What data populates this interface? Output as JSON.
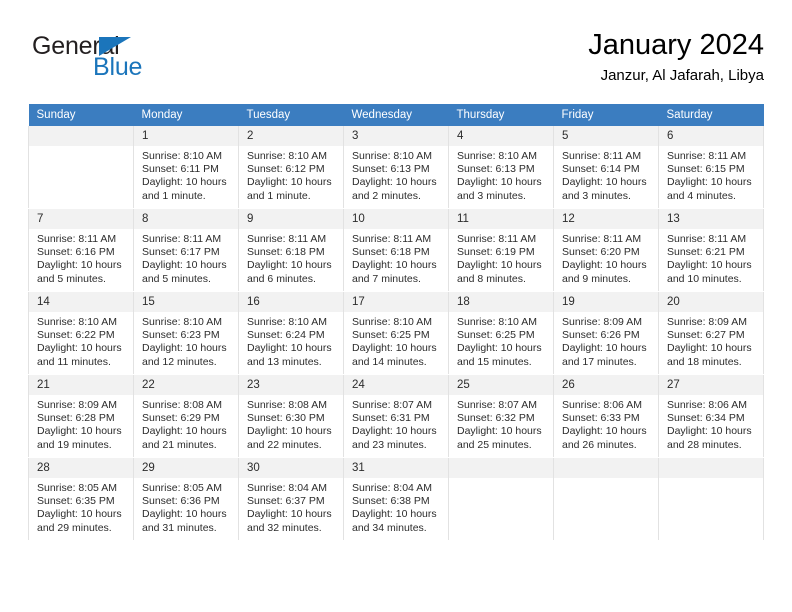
{
  "logo": {
    "word_top": "General",
    "word_bottom": "Blue",
    "triangle_color": "#1b75bb",
    "text_color": "#231f20"
  },
  "header": {
    "title": "January 2024",
    "subtitle": "Janzur, Al Jafarah, Libya"
  },
  "theme": {
    "header_bg": "#3b7dc0",
    "header_text": "#ffffff",
    "daynum_bg": "#f2f2f2",
    "cell_border": "#e2e2e2"
  },
  "weekday_headers": [
    "Sunday",
    "Monday",
    "Tuesday",
    "Wednesday",
    "Thursday",
    "Friday",
    "Saturday"
  ],
  "weeks": [
    [
      {
        "day": "",
        "sunrise": "",
        "sunset": "",
        "daylight": "",
        "blank": true
      },
      {
        "day": "1",
        "sunrise": "Sunrise: 8:10 AM",
        "sunset": "Sunset: 6:11 PM",
        "daylight": "Daylight: 10 hours and 1 minute."
      },
      {
        "day": "2",
        "sunrise": "Sunrise: 8:10 AM",
        "sunset": "Sunset: 6:12 PM",
        "daylight": "Daylight: 10 hours and 1 minute."
      },
      {
        "day": "3",
        "sunrise": "Sunrise: 8:10 AM",
        "sunset": "Sunset: 6:13 PM",
        "daylight": "Daylight: 10 hours and 2 minutes."
      },
      {
        "day": "4",
        "sunrise": "Sunrise: 8:10 AM",
        "sunset": "Sunset: 6:13 PM",
        "daylight": "Daylight: 10 hours and 3 minutes."
      },
      {
        "day": "5",
        "sunrise": "Sunrise: 8:11 AM",
        "sunset": "Sunset: 6:14 PM",
        "daylight": "Daylight: 10 hours and 3 minutes."
      },
      {
        "day": "6",
        "sunrise": "Sunrise: 8:11 AM",
        "sunset": "Sunset: 6:15 PM",
        "daylight": "Daylight: 10 hours and 4 minutes."
      }
    ],
    [
      {
        "day": "7",
        "sunrise": "Sunrise: 8:11 AM",
        "sunset": "Sunset: 6:16 PM",
        "daylight": "Daylight: 10 hours and 5 minutes."
      },
      {
        "day": "8",
        "sunrise": "Sunrise: 8:11 AM",
        "sunset": "Sunset: 6:17 PM",
        "daylight": "Daylight: 10 hours and 5 minutes."
      },
      {
        "day": "9",
        "sunrise": "Sunrise: 8:11 AM",
        "sunset": "Sunset: 6:18 PM",
        "daylight": "Daylight: 10 hours and 6 minutes."
      },
      {
        "day": "10",
        "sunrise": "Sunrise: 8:11 AM",
        "sunset": "Sunset: 6:18 PM",
        "daylight": "Daylight: 10 hours and 7 minutes."
      },
      {
        "day": "11",
        "sunrise": "Sunrise: 8:11 AM",
        "sunset": "Sunset: 6:19 PM",
        "daylight": "Daylight: 10 hours and 8 minutes."
      },
      {
        "day": "12",
        "sunrise": "Sunrise: 8:11 AM",
        "sunset": "Sunset: 6:20 PM",
        "daylight": "Daylight: 10 hours and 9 minutes."
      },
      {
        "day": "13",
        "sunrise": "Sunrise: 8:11 AM",
        "sunset": "Sunset: 6:21 PM",
        "daylight": "Daylight: 10 hours and 10 minutes."
      }
    ],
    [
      {
        "day": "14",
        "sunrise": "Sunrise: 8:10 AM",
        "sunset": "Sunset: 6:22 PM",
        "daylight": "Daylight: 10 hours and 11 minutes."
      },
      {
        "day": "15",
        "sunrise": "Sunrise: 8:10 AM",
        "sunset": "Sunset: 6:23 PM",
        "daylight": "Daylight: 10 hours and 12 minutes."
      },
      {
        "day": "16",
        "sunrise": "Sunrise: 8:10 AM",
        "sunset": "Sunset: 6:24 PM",
        "daylight": "Daylight: 10 hours and 13 minutes."
      },
      {
        "day": "17",
        "sunrise": "Sunrise: 8:10 AM",
        "sunset": "Sunset: 6:25 PM",
        "daylight": "Daylight: 10 hours and 14 minutes."
      },
      {
        "day": "18",
        "sunrise": "Sunrise: 8:10 AM",
        "sunset": "Sunset: 6:25 PM",
        "daylight": "Daylight: 10 hours and 15 minutes."
      },
      {
        "day": "19",
        "sunrise": "Sunrise: 8:09 AM",
        "sunset": "Sunset: 6:26 PM",
        "daylight": "Daylight: 10 hours and 17 minutes."
      },
      {
        "day": "20",
        "sunrise": "Sunrise: 8:09 AM",
        "sunset": "Sunset: 6:27 PM",
        "daylight": "Daylight: 10 hours and 18 minutes."
      }
    ],
    [
      {
        "day": "21",
        "sunrise": "Sunrise: 8:09 AM",
        "sunset": "Sunset: 6:28 PM",
        "daylight": "Daylight: 10 hours and 19 minutes."
      },
      {
        "day": "22",
        "sunrise": "Sunrise: 8:08 AM",
        "sunset": "Sunset: 6:29 PM",
        "daylight": "Daylight: 10 hours and 21 minutes."
      },
      {
        "day": "23",
        "sunrise": "Sunrise: 8:08 AM",
        "sunset": "Sunset: 6:30 PM",
        "daylight": "Daylight: 10 hours and 22 minutes."
      },
      {
        "day": "24",
        "sunrise": "Sunrise: 8:07 AM",
        "sunset": "Sunset: 6:31 PM",
        "daylight": "Daylight: 10 hours and 23 minutes."
      },
      {
        "day": "25",
        "sunrise": "Sunrise: 8:07 AM",
        "sunset": "Sunset: 6:32 PM",
        "daylight": "Daylight: 10 hours and 25 minutes."
      },
      {
        "day": "26",
        "sunrise": "Sunrise: 8:06 AM",
        "sunset": "Sunset: 6:33 PM",
        "daylight": "Daylight: 10 hours and 26 minutes."
      },
      {
        "day": "27",
        "sunrise": "Sunrise: 8:06 AM",
        "sunset": "Sunset: 6:34 PM",
        "daylight": "Daylight: 10 hours and 28 minutes."
      }
    ],
    [
      {
        "day": "28",
        "sunrise": "Sunrise: 8:05 AM",
        "sunset": "Sunset: 6:35 PM",
        "daylight": "Daylight: 10 hours and 29 minutes."
      },
      {
        "day": "29",
        "sunrise": "Sunrise: 8:05 AM",
        "sunset": "Sunset: 6:36 PM",
        "daylight": "Daylight: 10 hours and 31 minutes."
      },
      {
        "day": "30",
        "sunrise": "Sunrise: 8:04 AM",
        "sunset": "Sunset: 6:37 PM",
        "daylight": "Daylight: 10 hours and 32 minutes."
      },
      {
        "day": "31",
        "sunrise": "Sunrise: 8:04 AM",
        "sunset": "Sunset: 6:38 PM",
        "daylight": "Daylight: 10 hours and 34 minutes."
      },
      {
        "day": "",
        "sunrise": "",
        "sunset": "",
        "daylight": "",
        "blank": true
      },
      {
        "day": "",
        "sunrise": "",
        "sunset": "",
        "daylight": "",
        "blank": true
      },
      {
        "day": "",
        "sunrise": "",
        "sunset": "",
        "daylight": "",
        "blank": true
      }
    ]
  ]
}
